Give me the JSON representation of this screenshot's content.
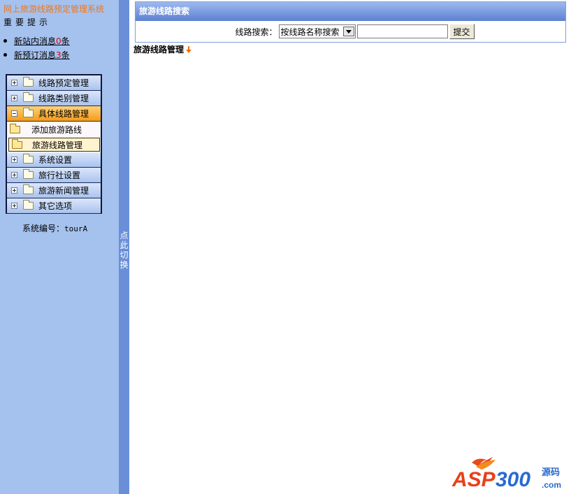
{
  "app": {
    "title": "网上旅游线路预定管理系统"
  },
  "notices": {
    "title": "重要提示",
    "items": [
      {
        "prefix": "新站内消息",
        "count": "0",
        "suffix": "条"
      },
      {
        "prefix": "新预订消息",
        "count": "3",
        "suffix": "条"
      }
    ]
  },
  "menu": {
    "top_items": [
      {
        "label": "线路预定管理"
      },
      {
        "label": "线路类别管理"
      },
      {
        "label": "具体线路管理"
      }
    ],
    "sub_items": [
      {
        "label": "添加旅游路线"
      },
      {
        "label": "旅游线路管理"
      }
    ],
    "bottom_items": [
      {
        "label": "系统设置"
      },
      {
        "label": "旅行社设置"
      },
      {
        "label": "旅游新闻管理"
      },
      {
        "label": "其它选项"
      }
    ]
  },
  "system": {
    "label": "系统编号：",
    "code": "tourA"
  },
  "toggle": {
    "label": "点此切换"
  },
  "search": {
    "header": "旅游线路搜索",
    "label": "线路搜索：",
    "select_value": "按线路名称搜索",
    "input_value": "",
    "submit_label": "提交"
  },
  "section": {
    "title": "旅游线路管理"
  },
  "watermark": {
    "text": "ASP300源码",
    "brand": "ASP300",
    "suffix": "源码",
    "sub": ".com"
  },
  "colors": {
    "sidebar_bg": "#a5c1ee",
    "toggle_bg": "#6a8fd8",
    "accent_orange": "#f07818",
    "count_red": "#e00000"
  }
}
